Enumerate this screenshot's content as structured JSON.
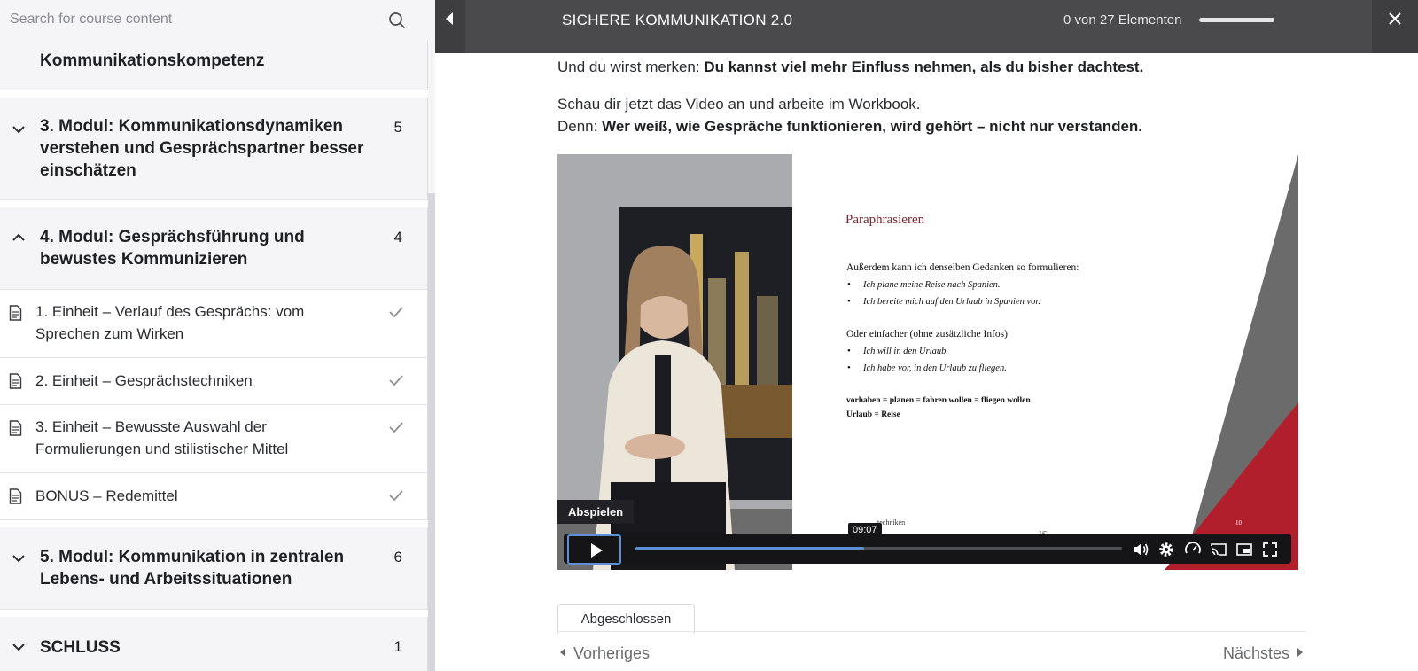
{
  "sidebar": {
    "search_placeholder": "Search for course content",
    "prev_section_tail": "Kommunikationskompetenz",
    "sections": [
      {
        "title": "3. Modul: Kommunikationsdynamiken verstehen und Gesprächspartner besser einschätzen",
        "count": "5",
        "state": "collapsed"
      },
      {
        "title": "4. Modul: Gesprächsführung und bewustes Kommunizieren",
        "count": "4",
        "state": "expanded"
      },
      {
        "title": "5. Modul: Kommunikation in zentralen Lebens- und Arbeitssituationen",
        "count": "6",
        "state": "collapsed"
      },
      {
        "title": "SCHLUSS",
        "count": "1",
        "state": "collapsed"
      }
    ],
    "units": [
      {
        "title": "1. Einheit – Verlauf des Gesprächs: vom Sprechen zum Wirken",
        "completed": true
      },
      {
        "title": "2. Einheit – Gesprächstechniken",
        "completed": true
      },
      {
        "title": "3. Einheit – Bewusste Auswahl der Formulierungen und stilistischer Mittel",
        "completed": true
      },
      {
        "title": "BONUS – Redemittel",
        "completed": true
      }
    ]
  },
  "header": {
    "course_title": "SICHERE KOMMUNIKATION 2.0",
    "progress_text": "0 von 27 Elementen",
    "progress_fraction": 0
  },
  "content": {
    "line1_prefix": "Und du wirst merken: ",
    "line1_bold": "Du kannst viel mehr Einfluss nehmen, als du bisher dachtest.",
    "line2": "Schau dir jetzt das Video an und arbeite im Workbook.",
    "line3_prefix": "Denn: ",
    "line3_bold": "Wer weiß, wie Gespräche funktionieren, wird gehört – nicht nur verstanden."
  },
  "video": {
    "play_tooltip": "Abspielen",
    "time_tooltip": "09:07",
    "progress_fraction": 0.47,
    "slide": {
      "title": "Paraphrasieren",
      "intro": "Außerdem kann ich denselben Gedanken so formulieren:",
      "bullets1": [
        "Ich plane meine Reise nach Spanien.",
        "Ich bereite mich auf den Urlaub in Spanien vor."
      ],
      "intro2": "Oder einfacher (ohne zusätzliche Infos)",
      "bullets2": [
        "Ich will in den Urlaub.",
        "Ich habe vor, in den Urlaub zu fliegen."
      ],
      "vocab1": "vorhaben = planen = fahren wollen = fliegen wollen",
      "vocab2": "Urlaub = Reise",
      "footer_left": "techniken",
      "page_number": "10",
      "logo": "IS"
    }
  },
  "footer": {
    "complete_label": "Abgeschlossen",
    "prev_label": "Vorheriges",
    "next_label": "Nächstes"
  },
  "colors": {
    "topbar": "#4a4a4d",
    "accent_blue": "#5b8fd8",
    "slide_title": "#7a2430",
    "slide_red": "#b01f2b"
  }
}
